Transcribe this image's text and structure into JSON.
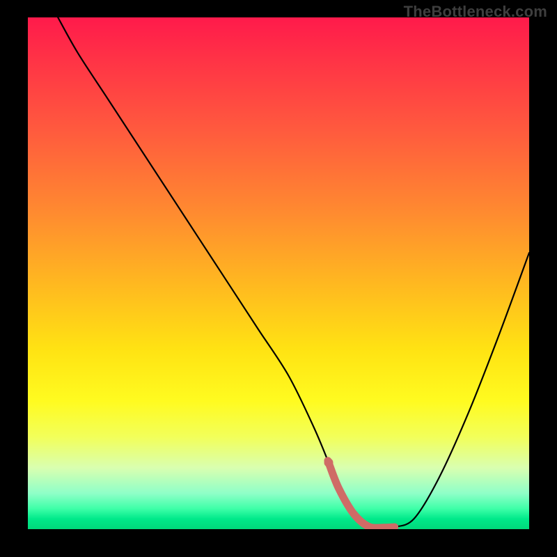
{
  "watermark": "TheBottleneck.com",
  "chart_data": {
    "type": "line",
    "title": "",
    "xlabel": "",
    "ylabel": "",
    "xlim": [
      0,
      100
    ],
    "ylim": [
      0,
      100
    ],
    "x": [
      6,
      10,
      16,
      22,
      28,
      34,
      40,
      46,
      52,
      57,
      60,
      62,
      65,
      68,
      71,
      73,
      77,
      82,
      88,
      94,
      100
    ],
    "values": [
      100,
      93,
      84,
      75,
      66,
      57,
      48,
      39,
      30,
      20,
      13,
      8,
      3,
      0.5,
      0.3,
      0.4,
      2,
      10,
      23,
      38,
      54
    ],
    "highlight_x_range": [
      60,
      73
    ],
    "gradient_stops": [
      {
        "pos": 0.0,
        "color": "#ff1a4b"
      },
      {
        "pos": 0.08,
        "color": "#ff3246"
      },
      {
        "pos": 0.22,
        "color": "#ff5a3e"
      },
      {
        "pos": 0.38,
        "color": "#ff8a30"
      },
      {
        "pos": 0.52,
        "color": "#ffb820"
      },
      {
        "pos": 0.65,
        "color": "#ffe313"
      },
      {
        "pos": 0.75,
        "color": "#fffb20"
      },
      {
        "pos": 0.82,
        "color": "#f2ff5a"
      },
      {
        "pos": 0.88,
        "color": "#d9ffb0"
      },
      {
        "pos": 0.93,
        "color": "#8fffc8"
      },
      {
        "pos": 0.96,
        "color": "#3effa8"
      },
      {
        "pos": 0.98,
        "color": "#00e98a"
      },
      {
        "pos": 1.0,
        "color": "#00d87a"
      }
    ],
    "colors": {
      "curve": "#000000",
      "highlight": "#cf6b66"
    }
  }
}
